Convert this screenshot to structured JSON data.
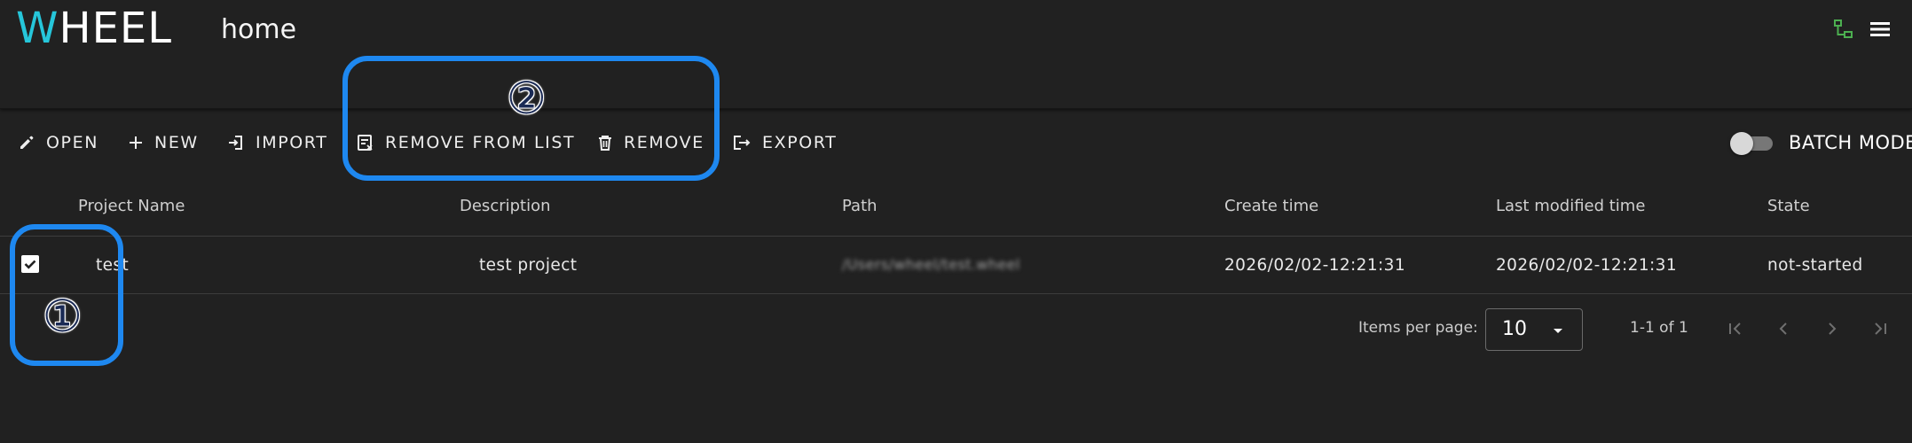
{
  "header": {
    "logo_accent": "W",
    "logo_rest": "HEEL",
    "title": "home",
    "icons": [
      "network-icon",
      "menu-icon"
    ]
  },
  "toolbar": {
    "open": "OPEN",
    "new": "NEW",
    "import": "IMPORT",
    "remove_from_list": "REMOVE FROM LIST",
    "remove": "REMOVE",
    "export": "EXPORT",
    "batch_mode": "BATCH MODE",
    "batch_mode_on": false
  },
  "table": {
    "columns": [
      "Project Name",
      "Description",
      "Path",
      "Create time",
      "Last modified time",
      "State"
    ],
    "rows": [
      {
        "checked": true,
        "name": "test",
        "description": "test project",
        "path": "/Users/wheel/test.wheel",
        "create_time": "2026/02/02-12:21:31",
        "modified_time": "2026/02/02-12:21:31",
        "state": "not-started"
      }
    ]
  },
  "pagination": {
    "items_per_page_label": "Items per page:",
    "items_per_page": "10",
    "range": "1-1 of 1"
  },
  "annotations": {
    "one": "①",
    "two": "②",
    "color": "#1e88f0"
  },
  "colors": {
    "background": "#212121",
    "logo_accent": "#26c6da",
    "network_icon": "#4caf50"
  }
}
